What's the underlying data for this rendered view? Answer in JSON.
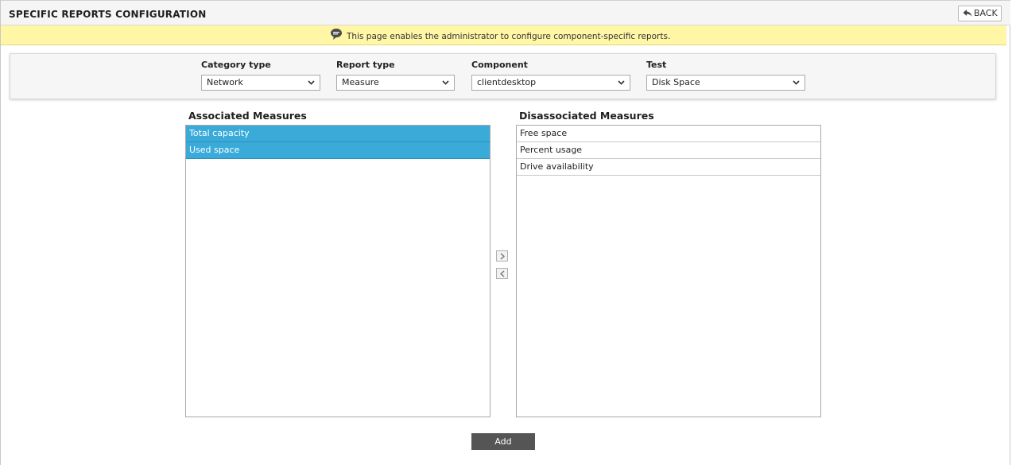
{
  "header": {
    "title": "SPECIFIC REPORTS CONFIGURATION",
    "back_label": "BACK"
  },
  "info": {
    "message": "This page enables the administrator to configure component-specific reports."
  },
  "filters": {
    "category": {
      "label": "Category type",
      "value": "Network"
    },
    "report": {
      "label": "Report type",
      "value": "Measure"
    },
    "component": {
      "label": "Component",
      "value": "clientdesktop"
    },
    "test": {
      "label": "Test",
      "value": "Disk Space"
    }
  },
  "associated": {
    "title": "Associated Measures",
    "items": [
      "Total capacity",
      "Used space"
    ]
  },
  "disassociated": {
    "title": "Disassociated Measures",
    "items": [
      "Free space",
      "Percent usage",
      "Drive availability"
    ]
  },
  "actions": {
    "add_label": "Add"
  },
  "colors": {
    "selected": "#3aabd9",
    "info_bar": "#fff6a6",
    "add_button": "#555555"
  }
}
